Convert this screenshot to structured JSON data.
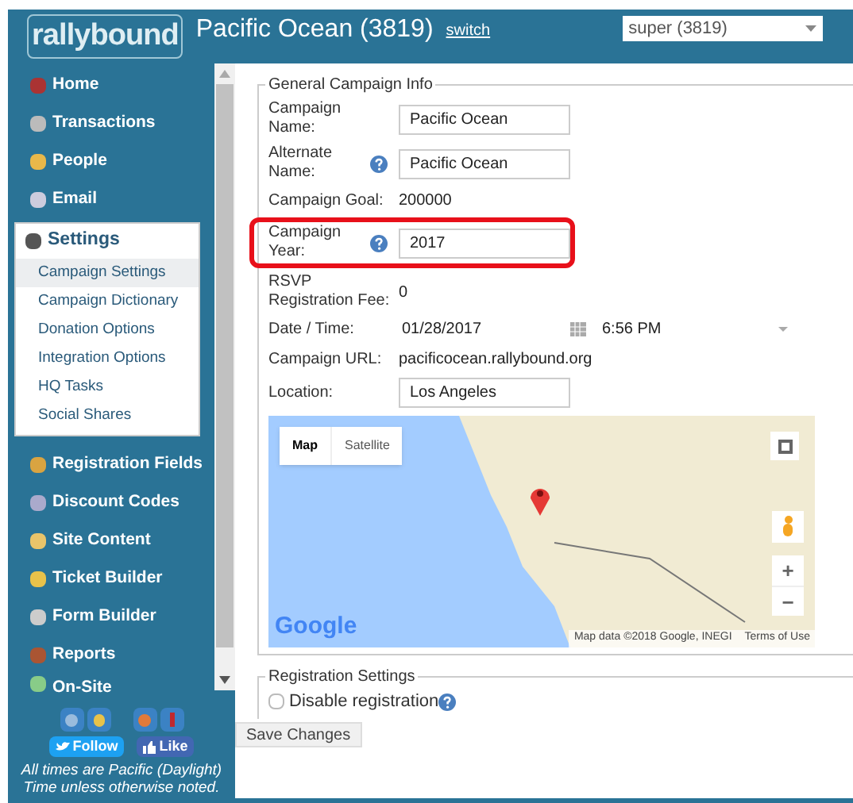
{
  "header": {
    "logo": "rallybound",
    "campaign": "Pacific Ocean (3819)",
    "switch_link": "switch",
    "account_select": "super (3819)"
  },
  "sidebar": {
    "items": [
      {
        "label": "Home",
        "expanded": false
      },
      {
        "label": "Transactions",
        "expanded": false
      },
      {
        "label": "People",
        "expanded": false
      },
      {
        "label": "Email",
        "expanded": false
      },
      {
        "label": "Settings",
        "expanded": true,
        "children": [
          {
            "label": "Campaign Settings",
            "selected": true
          },
          {
            "label": "Campaign Dictionary",
            "selected": false
          },
          {
            "label": "Donation Options",
            "selected": false
          },
          {
            "label": "Integration Options",
            "selected": false
          },
          {
            "label": "HQ Tasks",
            "selected": false
          },
          {
            "label": "Social Shares",
            "selected": false
          }
        ]
      },
      {
        "label": "Registration Fields",
        "expanded": false
      },
      {
        "label": "Discount Codes",
        "expanded": false
      },
      {
        "label": "Site Content",
        "expanded": false
      },
      {
        "label": "Ticket Builder",
        "expanded": false
      },
      {
        "label": "Form Builder",
        "expanded": false
      },
      {
        "label": "Reports",
        "expanded": false
      },
      {
        "label": "On-Site",
        "expanded": false
      }
    ],
    "follow_button": "Follow",
    "like_button": "Like",
    "note": "All times are Pacific (Daylight) Time unless otherwise noted."
  },
  "general_info": {
    "legend": "General Campaign Info",
    "fields": [
      {
        "kind": "input",
        "label": "Campaign Name:",
        "help": false,
        "highlighted": false,
        "value": "Pacific Ocean"
      },
      {
        "kind": "input",
        "label": "Alternate Name:",
        "help": true,
        "highlighted": false,
        "value": "Pacific Ocean"
      },
      {
        "kind": "text",
        "label": "Campaign Goal:",
        "help": false,
        "highlighted": false,
        "value": "200000"
      },
      {
        "kind": "input",
        "label": "Campaign Year:",
        "help": true,
        "highlighted": true,
        "value": "2017"
      },
      {
        "kind": "text",
        "label": "RSVP Registration Fee:",
        "help": false,
        "highlighted": false,
        "value": "0"
      },
      {
        "kind": "datetime",
        "label": "Date / Time:",
        "help": false,
        "highlighted": false,
        "value": "01/28/2017",
        "time": "6:56 PM"
      },
      {
        "kind": "text",
        "label": "Campaign URL:",
        "help": false,
        "highlighted": false,
        "value": "pacificocean.rallybound.org"
      },
      {
        "kind": "input",
        "label": "Location:",
        "help": false,
        "highlighted": false,
        "value": "Los Angeles"
      }
    ],
    "map": {
      "tabs": [
        {
          "label": "Map",
          "selected": true
        },
        {
          "label": "Satellite",
          "selected": false
        }
      ],
      "logo": "Google",
      "attribution": "Map data ©2018 Google, INEGI",
      "terms": "Terms of Use",
      "zoom_in": "+",
      "zoom_out": "−"
    }
  },
  "registration_settings": {
    "legend": "Registration Settings",
    "disable_registration": {
      "label": "Disable registration",
      "checked": false
    }
  },
  "save_button": "Save Changes"
}
